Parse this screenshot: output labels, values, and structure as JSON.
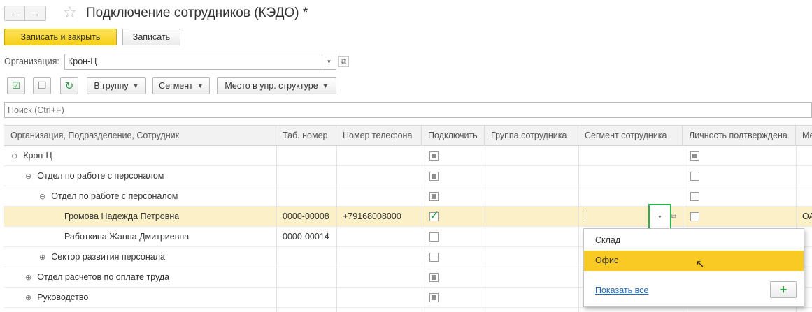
{
  "window": {
    "title": "Подключение сотрудников (КЭДО) *"
  },
  "toolbar": {
    "save_close": "Записать и закрыть",
    "save": "Записать"
  },
  "org": {
    "label": "Организация:",
    "value": "Крон-Ц"
  },
  "buttons": {
    "group": "В группу",
    "segment": "Сегмент",
    "place": "Место в упр. структуре"
  },
  "search": {
    "placeholder": "Поиск (Ctrl+F)"
  },
  "table": {
    "columns": [
      "Организация, Подразделение, Сотрудник",
      "Таб. номер",
      "Номер телефона",
      "Подключить",
      "Группа сотрудника",
      "Сегмент сотрудника",
      "Личность подтверждена",
      "Ме"
    ],
    "rows": [
      {
        "name": "Крон-Ц",
        "tab": "",
        "phone": "",
        "toggle": "⊖",
        "connect": "mixed",
        "verified": "mixed"
      },
      {
        "name": "Отдел по работе с персоналом",
        "tab": "",
        "phone": "",
        "toggle": "⊖",
        "connect": "mixed",
        "verified": "unchecked"
      },
      {
        "name": "Отдел по работе с персоналом",
        "tab": "",
        "phone": "",
        "toggle": "⊖",
        "connect": "mixed",
        "verified": "unchecked"
      },
      {
        "name": "Громова Надежда Петровна",
        "tab": "0000-00008",
        "phone": "+79168008000",
        "toggle": "",
        "connect": "checked",
        "verified": "unchecked",
        "extra": "ОА"
      },
      {
        "name": "Работкина Жанна Дмитриевна",
        "tab": "0000-00014",
        "phone": "",
        "toggle": "",
        "connect": "unchecked",
        "verified": ""
      },
      {
        "name": "Сектор развития персонала",
        "tab": "",
        "phone": "",
        "toggle": "⊕",
        "connect": "unchecked",
        "verified": ""
      },
      {
        "name": "Отдел расчетов по оплате труда",
        "tab": "",
        "phone": "",
        "toggle": "⊕",
        "connect": "mixed",
        "verified": ""
      },
      {
        "name": "Руководство",
        "tab": "",
        "phone": "",
        "toggle": "⊕",
        "connect": "mixed",
        "verified": ""
      }
    ]
  },
  "dropdown": {
    "options": [
      "Склад",
      "Офис"
    ],
    "show_all": "Показать все",
    "add": "+"
  },
  "colors": {
    "accent_yellow": "#f5cf17",
    "selected_row": "#fbf0c8",
    "highlight_option": "#f9c924",
    "focus_green": "#2bb24c",
    "link": "#1e6bbd"
  }
}
